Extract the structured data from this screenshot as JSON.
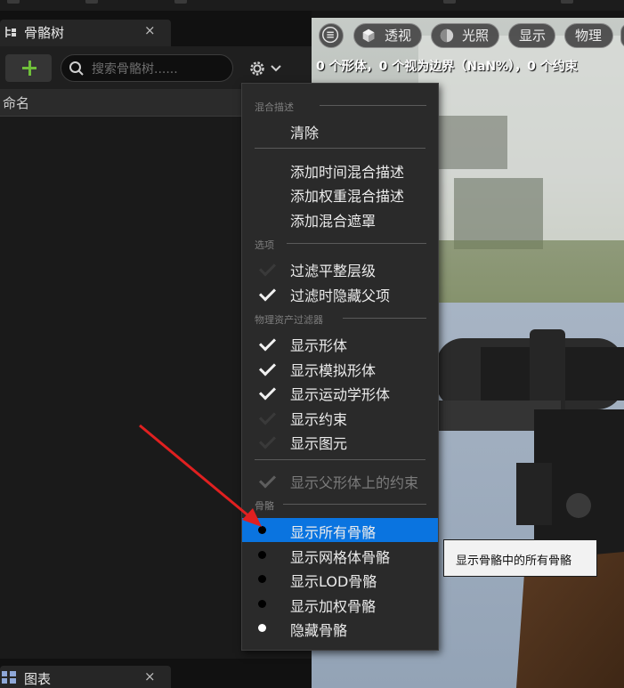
{
  "skeleton_tree_panel": {
    "tab_title": "骨骼树",
    "tab_close": "×",
    "search_placeholder": "搜索骨骼树......",
    "column_header": "命名"
  },
  "bottom_panel": {
    "tab_title": "图表",
    "tab_close": "×"
  },
  "viewport": {
    "buttons": {
      "perspective": "透视",
      "lighting": "光照",
      "show": "显示",
      "physics": "物理"
    },
    "stats_text": "0 个形体，0 个视为边界（NaN%），0 个约束"
  },
  "menu": {
    "sections": {
      "blend": "混合描述",
      "options": "选项",
      "physics_filter": "物理资产过滤器",
      "bones": "骨骼"
    },
    "items": {
      "clear": "清除",
      "add_time_blend": "添加时间混合描述",
      "add_weight_blend": "添加权重混合描述",
      "add_blend_mask": "添加混合遮罩",
      "filter_flatten": "过滤平整层级",
      "hide_parent": "过滤时隐藏父项",
      "show_bodies": "显示形体",
      "show_sim_bodies": "显示模拟形体",
      "show_kinematic_bodies": "显示运动学形体",
      "show_constraints": "显示约束",
      "show_primitives": "显示图元",
      "show_parent_constraints": "显示父形体上的约束",
      "show_all_bones": "显示所有骨骼",
      "show_mesh_bones": "显示网格体骨骼",
      "show_lod_bones": "显示LOD骨骼",
      "show_weighted_bones": "显示加权骨骼",
      "hide_bones": "隐藏骨骼"
    }
  },
  "tooltip": {
    "text": "显示骨骼中的所有骨骼"
  },
  "colors": {
    "selection": "#0a74e0",
    "add_icon": "#6fbf3a",
    "annotation_arrow": "#e02020"
  }
}
